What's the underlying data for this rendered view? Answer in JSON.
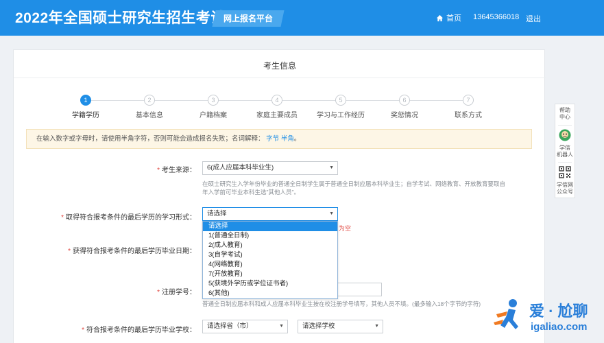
{
  "header": {
    "title": "2022年全国硕士研究生招生考试",
    "platform": "网上报名平台",
    "home": "首页",
    "phone": "13645366018",
    "logout": "退出"
  },
  "card": {
    "title": "考生信息"
  },
  "steps": [
    {
      "num": "1",
      "label": "学籍学历"
    },
    {
      "num": "2",
      "label": "基本信息"
    },
    {
      "num": "3",
      "label": "户籍档案"
    },
    {
      "num": "4",
      "label": "家庭主要成员"
    },
    {
      "num": "5",
      "label": "学习与工作经历"
    },
    {
      "num": "6",
      "label": "奖惩情况"
    },
    {
      "num": "7",
      "label": "联系方式"
    }
  ],
  "notice": {
    "text": "在输入数字或字母时，请使用半角字符，否则可能会造成报名失败；名词解释：",
    "link1": "字节",
    "link2": "半角",
    "end": "。"
  },
  "form": {
    "source": {
      "required": "*",
      "label": "考生来源：",
      "value": "6(成人应届本科毕业生)",
      "hint1": "在硕士研究生入学年份毕业的普通全日制学生属于普通全日制应届本科毕业生；自学考试、网络教育、开放教育要取自",
      "hint2": "年入学前可毕业本科生选\"其他人员\"。"
    },
    "study_form": {
      "required": "*",
      "label": "取得符合报考条件的最后学历的学习形式：",
      "value": "请选择",
      "error_fragment": "为空"
    },
    "grad_date": {
      "required": "*",
      "label": "获得符合报考条件的最后学历毕业日期："
    },
    "reg_no": {
      "required": "*",
      "label": "注册学号：",
      "hint": "普通全日制应届本科和成人应届本科毕业生按在校注册学号填写，其他人员不填。(最多输入18个字节的字符)"
    },
    "school": {
      "required": "*",
      "label": "符合报考条件的最后学历毕业学校：",
      "province_value": "请选择省（市）",
      "school_value": "请选择学校"
    }
  },
  "dropdown": {
    "options": [
      "请选择",
      "1(普通全日制)",
      "2(成人教育)",
      "3(自学考试)",
      "4(网络教育)",
      "7(开放教育)",
      "5(获境外学历或学位证书者)",
      "6(其他)"
    ],
    "selected_index": 0
  },
  "side": {
    "help1": "帮助",
    "help2": "中心",
    "robot1": "学信",
    "robot2": "机器人",
    "wechat1": "学信网",
    "wechat2": "公众号"
  },
  "watermark": {
    "cn": "爱 · 尬聊",
    "en": "igaliao.com"
  },
  "colors": {
    "primary": "#1f8ee6",
    "required": "#e0463f",
    "notice_bg": "#fdf6e6"
  }
}
